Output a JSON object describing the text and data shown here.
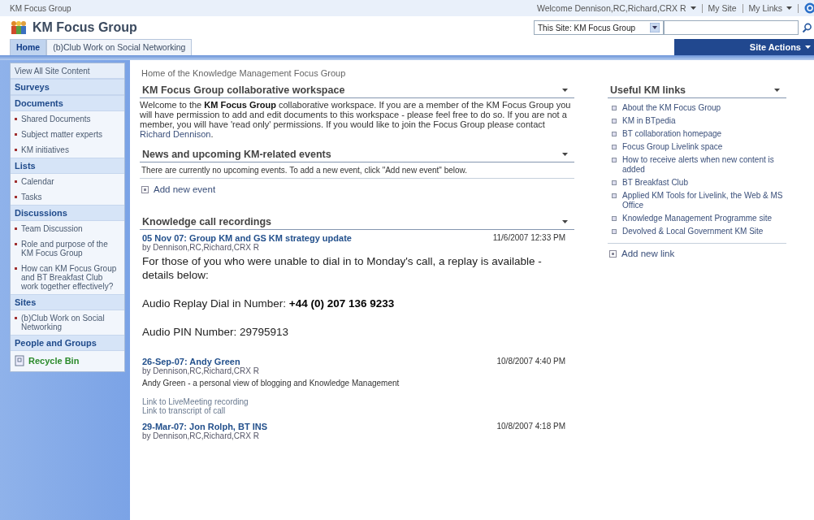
{
  "top_bar": {
    "site_name": "KM Focus Group",
    "welcome": "Welcome Dennison,RC,Richard,CRX R",
    "my_site": "My Site",
    "my_links": "My Links"
  },
  "header": {
    "title": "KM Focus Group",
    "search_scope": "This Site: KM Focus Group"
  },
  "tabs": [
    {
      "label": "Home",
      "selected": true
    },
    {
      "label": "(b)Club Work on Social Networking",
      "selected": false
    }
  ],
  "site_actions": "Site Actions",
  "sidebar": {
    "items": [
      {
        "kind": "plain",
        "label": "View All Site Content"
      },
      {
        "kind": "heading",
        "label": "Surveys"
      },
      {
        "kind": "heading",
        "label": "Documents"
      },
      {
        "kind": "link",
        "label": "Shared Documents"
      },
      {
        "kind": "link",
        "label": "Subject matter experts"
      },
      {
        "kind": "link",
        "label": "KM initiatives"
      },
      {
        "kind": "heading",
        "label": "Lists"
      },
      {
        "kind": "link",
        "label": "Calendar"
      },
      {
        "kind": "link",
        "label": "Tasks"
      },
      {
        "kind": "heading",
        "label": "Discussions"
      },
      {
        "kind": "link",
        "label": "Team Discussion"
      },
      {
        "kind": "link",
        "label": "Role and purpose of the KM Focus Group"
      },
      {
        "kind": "link",
        "label": "How can KM Focus Group and BT Breakfast Club work together effectively?"
      },
      {
        "kind": "heading",
        "label": "Sites"
      },
      {
        "kind": "link",
        "label": "(b)Club Work on Social Networking"
      },
      {
        "kind": "heading",
        "label": "People and Groups"
      },
      {
        "kind": "recycle",
        "label": "Recycle Bin"
      }
    ]
  },
  "description": "Home of the Knowledge Management Focus Group",
  "workspace": {
    "title": "KM Focus Group collaborative workspace",
    "text": "Welcome to the **KM Focus Group** collaborative workspace. If you are a member of the KM Focus Group you will have permission to add and edit documents to this workspace - please feel free to do so. If you are not a member, you will have 'read only' permissions. If you would like to join the Focus Group please contact",
    "contact_link": "Richard Dennison",
    "text_end": "."
  },
  "events": {
    "title": "News and upcoming KM-related events",
    "message": "There are currently no upcoming events. To add a new event, click \"Add new event\" below.",
    "add_link": "Add new event"
  },
  "recordings": {
    "title": "Knowledge call recordings",
    "items": [
      {
        "title": "05 Nov 07: Group KM and GS KM strategy update",
        "date": "11/6/2007 12:33 PM",
        "author": "by Dennison,RC,Richard,CRX R",
        "body": [
          {
            "kind": "large",
            "text": "For those of you who were unable to dial in to Monday's call, a replay is available - details below:"
          },
          {
            "kind": "large",
            "text": "Audio Replay Dial in Number: **+44 (0) 207 136 9233**"
          },
          {
            "kind": "large",
            "text": "Audio PIN Number: 29795913"
          }
        ]
      },
      {
        "title": "26-Sep-07: Andy Green",
        "date": "10/8/2007 4:40 PM",
        "author": "by Dennison,RC,Richard,CRX R",
        "body": [
          {
            "kind": "small",
            "text": "Andy Green - a personal view of blogging and Knowledge Management"
          }
        ],
        "links": [
          "Link to LiveMeeting recording",
          "Link to transcript of call"
        ]
      },
      {
        "title": "29-Mar-07: Jon Rolph, BT INS",
        "date": "10/8/2007 4:18 PM",
        "author": "by Dennison,RC,Richard,CRX R"
      }
    ]
  },
  "useful_links": {
    "title": "Useful KM links",
    "items": [
      "About the KM Focus Group",
      "KM in BTpedia",
      "BT collaboration homepage",
      "Focus Group Livelink space",
      "How to receive alerts when new content is added",
      "BT Breakfast Club",
      "Applied KM Tools for Livelink, the Web & MS Office",
      "Knowledge Management Programme site",
      "Devolved & Local Government KM Site"
    ],
    "add_link": "Add new link"
  }
}
